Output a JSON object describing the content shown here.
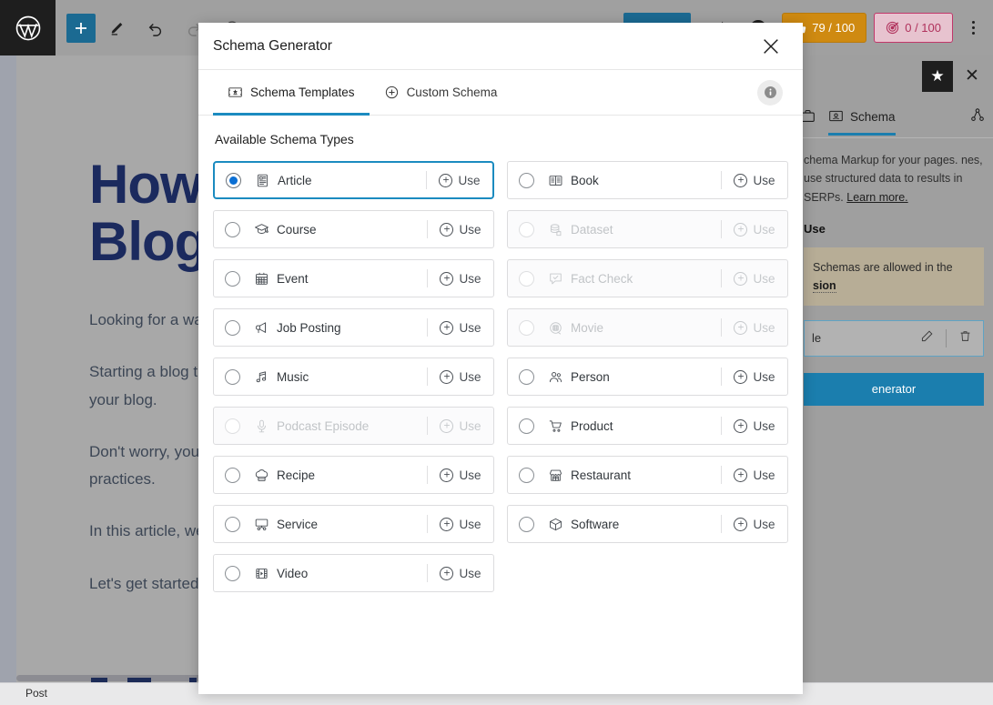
{
  "toolbar": {
    "logo": "wordpress-logo",
    "add_block": "+",
    "scores": [
      {
        "id": "readability",
        "value": "79 / 100",
        "color": "#cf8a11"
      },
      {
        "id": "seo",
        "value": "0 / 100",
        "color": "#b0325c"
      }
    ]
  },
  "editor": {
    "title": "How to Increase Blog Traffic: A Complete Guide for Your Blog",
    "title_line1": "How to Increase",
    "title_line2": "Blog Traffic",
    "paragraphs": [
      "Looking for a way to increase your blog traffic?",
      "Starting a blog that earns is not an easy task. However, once it grows, you need more traffic to your blog.",
      "Don't worry, you are at the right place. You can easily increase blog traffic with a few best practices.",
      "In this article, we will discuss how to grow your blog traffic from scratch.",
      "Let's get started."
    ],
    "status_bar_label": "Post"
  },
  "sidebar": {
    "star_icon": "star-icon",
    "close_icon": "close-icon",
    "tabs": [
      {
        "id": "general",
        "label": "",
        "icon": "briefcase-icon",
        "active": false
      },
      {
        "id": "schema",
        "label": "Schema",
        "icon": "schema-icon",
        "active": true
      },
      {
        "id": "social",
        "label": "",
        "icon": "share-nodes-icon",
        "active": false
      }
    ],
    "description_lines": [
      "chema Markup for your pages.",
      "nes, use structured data to",
      "results in SERPs."
    ],
    "learn_more": "Learn more.",
    "subheading": "Use",
    "notice_line1": "Schemas are allowed in the",
    "notice_link": "sion",
    "selected_schema": "le",
    "edit_icon": "edit-icon",
    "delete_icon": "trash-icon",
    "cta_label": "enerator"
  },
  "modal": {
    "title": "Schema Generator",
    "close_icon": "close-icon",
    "info_icon": "info-icon",
    "tabs": [
      {
        "id": "templates",
        "label": "Schema Templates",
        "icon": "schema-template-icon",
        "active": true
      },
      {
        "id": "custom",
        "label": "Custom Schema",
        "icon": "plus-circle-icon",
        "active": false
      }
    ],
    "section_title": "Available Schema Types",
    "use_label": "Use",
    "accent_color": "#1b8bc0",
    "selected_radio_color": "#0b6fd4",
    "schema_types": [
      {
        "id": "article",
        "label": "Article",
        "icon": "article-icon",
        "selected": true,
        "disabled": false,
        "column": "left"
      },
      {
        "id": "book",
        "label": "Book",
        "icon": "book-icon",
        "selected": false,
        "disabled": false,
        "column": "right"
      },
      {
        "id": "course",
        "label": "Course",
        "icon": "course-icon",
        "selected": false,
        "disabled": false,
        "column": "left"
      },
      {
        "id": "dataset",
        "label": "Dataset",
        "icon": "dataset-icon",
        "selected": false,
        "disabled": true,
        "column": "right"
      },
      {
        "id": "event",
        "label": "Event",
        "icon": "calendar-icon",
        "selected": false,
        "disabled": false,
        "column": "left"
      },
      {
        "id": "fact-check",
        "label": "Fact Check",
        "icon": "fact-check-icon",
        "selected": false,
        "disabled": true,
        "column": "right"
      },
      {
        "id": "job-posting",
        "label": "Job Posting",
        "icon": "megaphone-icon",
        "selected": false,
        "disabled": false,
        "column": "left"
      },
      {
        "id": "movie",
        "label": "Movie",
        "icon": "movie-icon",
        "selected": false,
        "disabled": true,
        "column": "right"
      },
      {
        "id": "music",
        "label": "Music",
        "icon": "music-icon",
        "selected": false,
        "disabled": false,
        "column": "left"
      },
      {
        "id": "person",
        "label": "Person",
        "icon": "person-icon",
        "selected": false,
        "disabled": false,
        "column": "right"
      },
      {
        "id": "podcast-episode",
        "label": "Podcast Episode",
        "icon": "microphone-icon",
        "selected": false,
        "disabled": true,
        "column": "left"
      },
      {
        "id": "product",
        "label": "Product",
        "icon": "cart-icon",
        "selected": false,
        "disabled": false,
        "column": "right"
      },
      {
        "id": "recipe",
        "label": "Recipe",
        "icon": "chef-hat-icon",
        "selected": false,
        "disabled": false,
        "column": "left"
      },
      {
        "id": "restaurant",
        "label": "Restaurant",
        "icon": "storefront-icon",
        "selected": false,
        "disabled": false,
        "column": "right"
      },
      {
        "id": "service",
        "label": "Service",
        "icon": "service-icon",
        "selected": false,
        "disabled": false,
        "column": "left"
      },
      {
        "id": "software",
        "label": "Software",
        "icon": "box-icon",
        "selected": false,
        "disabled": false,
        "column": "right"
      },
      {
        "id": "video",
        "label": "Video",
        "icon": "film-icon",
        "selected": false,
        "disabled": false,
        "column": "left"
      }
    ]
  }
}
